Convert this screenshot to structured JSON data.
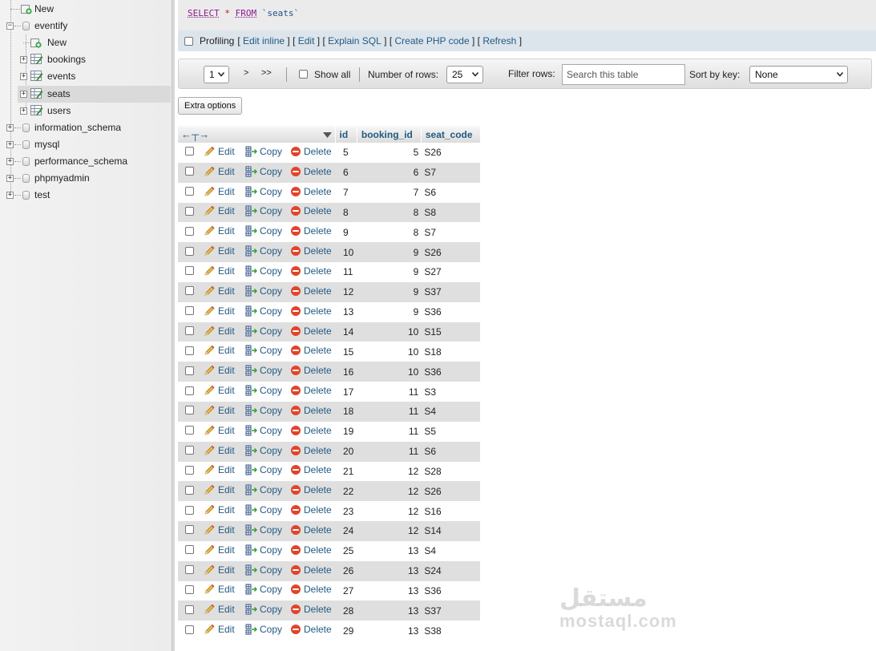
{
  "navigation": {
    "items": [
      {
        "label": "New",
        "kind": "new",
        "level": 1
      },
      {
        "label": "eventify",
        "kind": "db",
        "level": 1
      },
      {
        "label": "New",
        "kind": "new",
        "level": 2
      },
      {
        "label": "bookings",
        "kind": "table",
        "level": 2
      },
      {
        "label": "events",
        "kind": "table",
        "level": 2
      },
      {
        "label": "seats",
        "kind": "table",
        "level": 2,
        "selected": true
      },
      {
        "label": "users",
        "kind": "table",
        "level": 2
      },
      {
        "label": "information_schema",
        "kind": "db",
        "level": 1
      },
      {
        "label": "mysql",
        "kind": "db",
        "level": 1
      },
      {
        "label": "performance_schema",
        "kind": "db",
        "level": 1
      },
      {
        "label": "phpmyadmin",
        "kind": "db",
        "level": 1
      },
      {
        "label": "test",
        "kind": "db",
        "level": 1
      }
    ]
  },
  "sql_query": {
    "keyword_select": "SELECT",
    "star": "*",
    "keyword_from": "FROM",
    "table": "`seats`"
  },
  "profiling": {
    "label": "Profiling",
    "links": [
      "Edit inline",
      "Edit",
      "Explain SQL",
      "Create PHP code",
      "Refresh"
    ]
  },
  "navbar": {
    "page": "1",
    "next": ">",
    "last": ">>",
    "show_all": "Show all",
    "rows_label": "Number of rows:",
    "rows_value": "25",
    "filter_label": "Filter rows:",
    "filter_placeholder": "Search this table",
    "sort_label": "Sort by key:",
    "sort_value": "None"
  },
  "extra_options": "Extra options",
  "table": {
    "columns": [
      "id",
      "booking_id",
      "seat_code"
    ],
    "action_labels": {
      "edit": "Edit",
      "copy": "Copy",
      "delete": "Delete"
    },
    "rows": [
      {
        "id": "5",
        "booking_id": "5",
        "seat_code": "S26"
      },
      {
        "id": "6",
        "booking_id": "6",
        "seat_code": "S7"
      },
      {
        "id": "7",
        "booking_id": "7",
        "seat_code": "S6"
      },
      {
        "id": "8",
        "booking_id": "8",
        "seat_code": "S8"
      },
      {
        "id": "9",
        "booking_id": "8",
        "seat_code": "S7"
      },
      {
        "id": "10",
        "booking_id": "9",
        "seat_code": "S26"
      },
      {
        "id": "11",
        "booking_id": "9",
        "seat_code": "S27"
      },
      {
        "id": "12",
        "booking_id": "9",
        "seat_code": "S37"
      },
      {
        "id": "13",
        "booking_id": "9",
        "seat_code": "S36"
      },
      {
        "id": "14",
        "booking_id": "10",
        "seat_code": "S15"
      },
      {
        "id": "15",
        "booking_id": "10",
        "seat_code": "S18"
      },
      {
        "id": "16",
        "booking_id": "10",
        "seat_code": "S36"
      },
      {
        "id": "17",
        "booking_id": "11",
        "seat_code": "S3"
      },
      {
        "id": "18",
        "booking_id": "11",
        "seat_code": "S4"
      },
      {
        "id": "19",
        "booking_id": "11",
        "seat_code": "S5"
      },
      {
        "id": "20",
        "booking_id": "11",
        "seat_code": "S6"
      },
      {
        "id": "21",
        "booking_id": "12",
        "seat_code": "S28"
      },
      {
        "id": "22",
        "booking_id": "12",
        "seat_code": "S26"
      },
      {
        "id": "23",
        "booking_id": "12",
        "seat_code": "S16"
      },
      {
        "id": "24",
        "booking_id": "12",
        "seat_code": "S14"
      },
      {
        "id": "25",
        "booking_id": "13",
        "seat_code": "S4"
      },
      {
        "id": "26",
        "booking_id": "13",
        "seat_code": "S24"
      },
      {
        "id": "27",
        "booking_id": "13",
        "seat_code": "S36"
      },
      {
        "id": "28",
        "booking_id": "13",
        "seat_code": "S37"
      },
      {
        "id": "29",
        "booking_id": "13",
        "seat_code": "S38"
      }
    ]
  },
  "watermark": {
    "arabic": "مستقل",
    "latin": "mostaql.com"
  },
  "colors": {
    "link": "#235a81",
    "row_alt": "#dfdfdf",
    "sql_keyword": "#8b1b8b",
    "delete": "#e0442a"
  }
}
